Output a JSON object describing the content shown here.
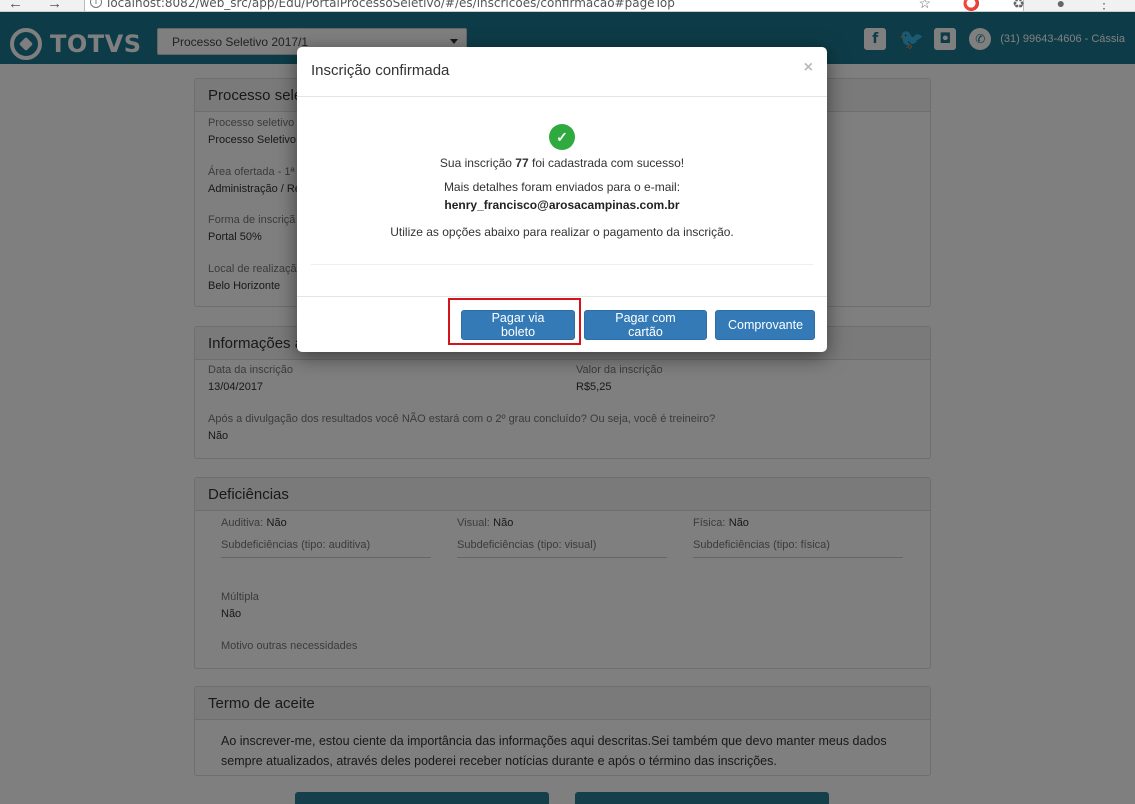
{
  "browser": {
    "nav_buttons": "← → C",
    "url": "localhost:8082/web_src/app/Edu/PortalProcessoSeletivo/#/es/inscricoes/confirmacao#pageTop",
    "info_icon": "i",
    "tools": "☆ ⭕ ♻ ● ⋮"
  },
  "header": {
    "logo_text": "TOTVS",
    "process_select_value": "Processo Seletivo 2017/1",
    "social_facebook": "f",
    "social_twitter": "🐦",
    "social_instagram": "◘",
    "social_whatsapp": "✆",
    "phone": "(31) 99643-4606 - Cássia"
  },
  "process_card": {
    "title": "Processo sele",
    "fields": [
      {
        "label": "Processo seletivo",
        "value": "Processo Seletivo"
      },
      {
        "label": "Área ofertada - 1ª o",
        "value": "Administração / Re"
      },
      {
        "label": "Forma de inscriçã",
        "value": "Portal 50%"
      },
      {
        "label": "Local de realizaçã",
        "value": "Belo Horizonte"
      }
    ]
  },
  "info_card": {
    "title": "Informações a",
    "date_label": "Data da inscrição",
    "date_value": "13/04/2017",
    "fee_label": "Valor da inscrição",
    "fee_value": "R$5,25",
    "question_label": "Após a divulgação dos resultados você NÃO estará com o 2º grau concluído? Ou seja, você é treineiro?",
    "question_value": "Não"
  },
  "deficiencias_card": {
    "title": "Deficiências",
    "auditiva_label": "Auditiva:",
    "auditiva_value": "Não",
    "visual_label": "Visual:",
    "visual_value": "Não",
    "fisica_label": "Física:",
    "fisica_value": "Não",
    "sub_auditiva": "Subdeficiências (tipo: auditiva)",
    "sub_visual": "Subdeficiências (tipo: visual)",
    "sub_fisica": "Subdeficiências (tipo: física)",
    "multipla_label": "Múltipla",
    "multipla_value": "Não",
    "motivo_label": "Motivo outras necessidades"
  },
  "terms_card": {
    "title": "Termo de aceite",
    "text": "Ao inscrever-me, estou ciente da importância das informações aqui descritas.Sei também que devo manter meus dados sempre atualizados, através deles poderei receber notícias durante e após o término das inscrições."
  },
  "modal": {
    "title": "Inscrição confirmada",
    "close": "×",
    "check_icon": "✓",
    "msg_prefix": "Sua inscrição",
    "inscricao_number": "77",
    "msg_suffix": "foi cadastrada com sucesso!",
    "details_msg": "Mais detalhes foram enviados para o e-mail:",
    "email": "henry_francisco@arosacampinas.com.br",
    "payment_msg": "Utilize as opções abaixo para realizar o pagamento da inscrição.",
    "btn_boleto": "Pagar via boleto",
    "btn_cartao": "Pagar com cartão",
    "btn_comprovante": "Comprovante"
  },
  "colors": {
    "header_bg": "#1a7891",
    "primary_button": "#337ab7",
    "success": "#2eaa3f",
    "highlight": "#d4131b"
  }
}
